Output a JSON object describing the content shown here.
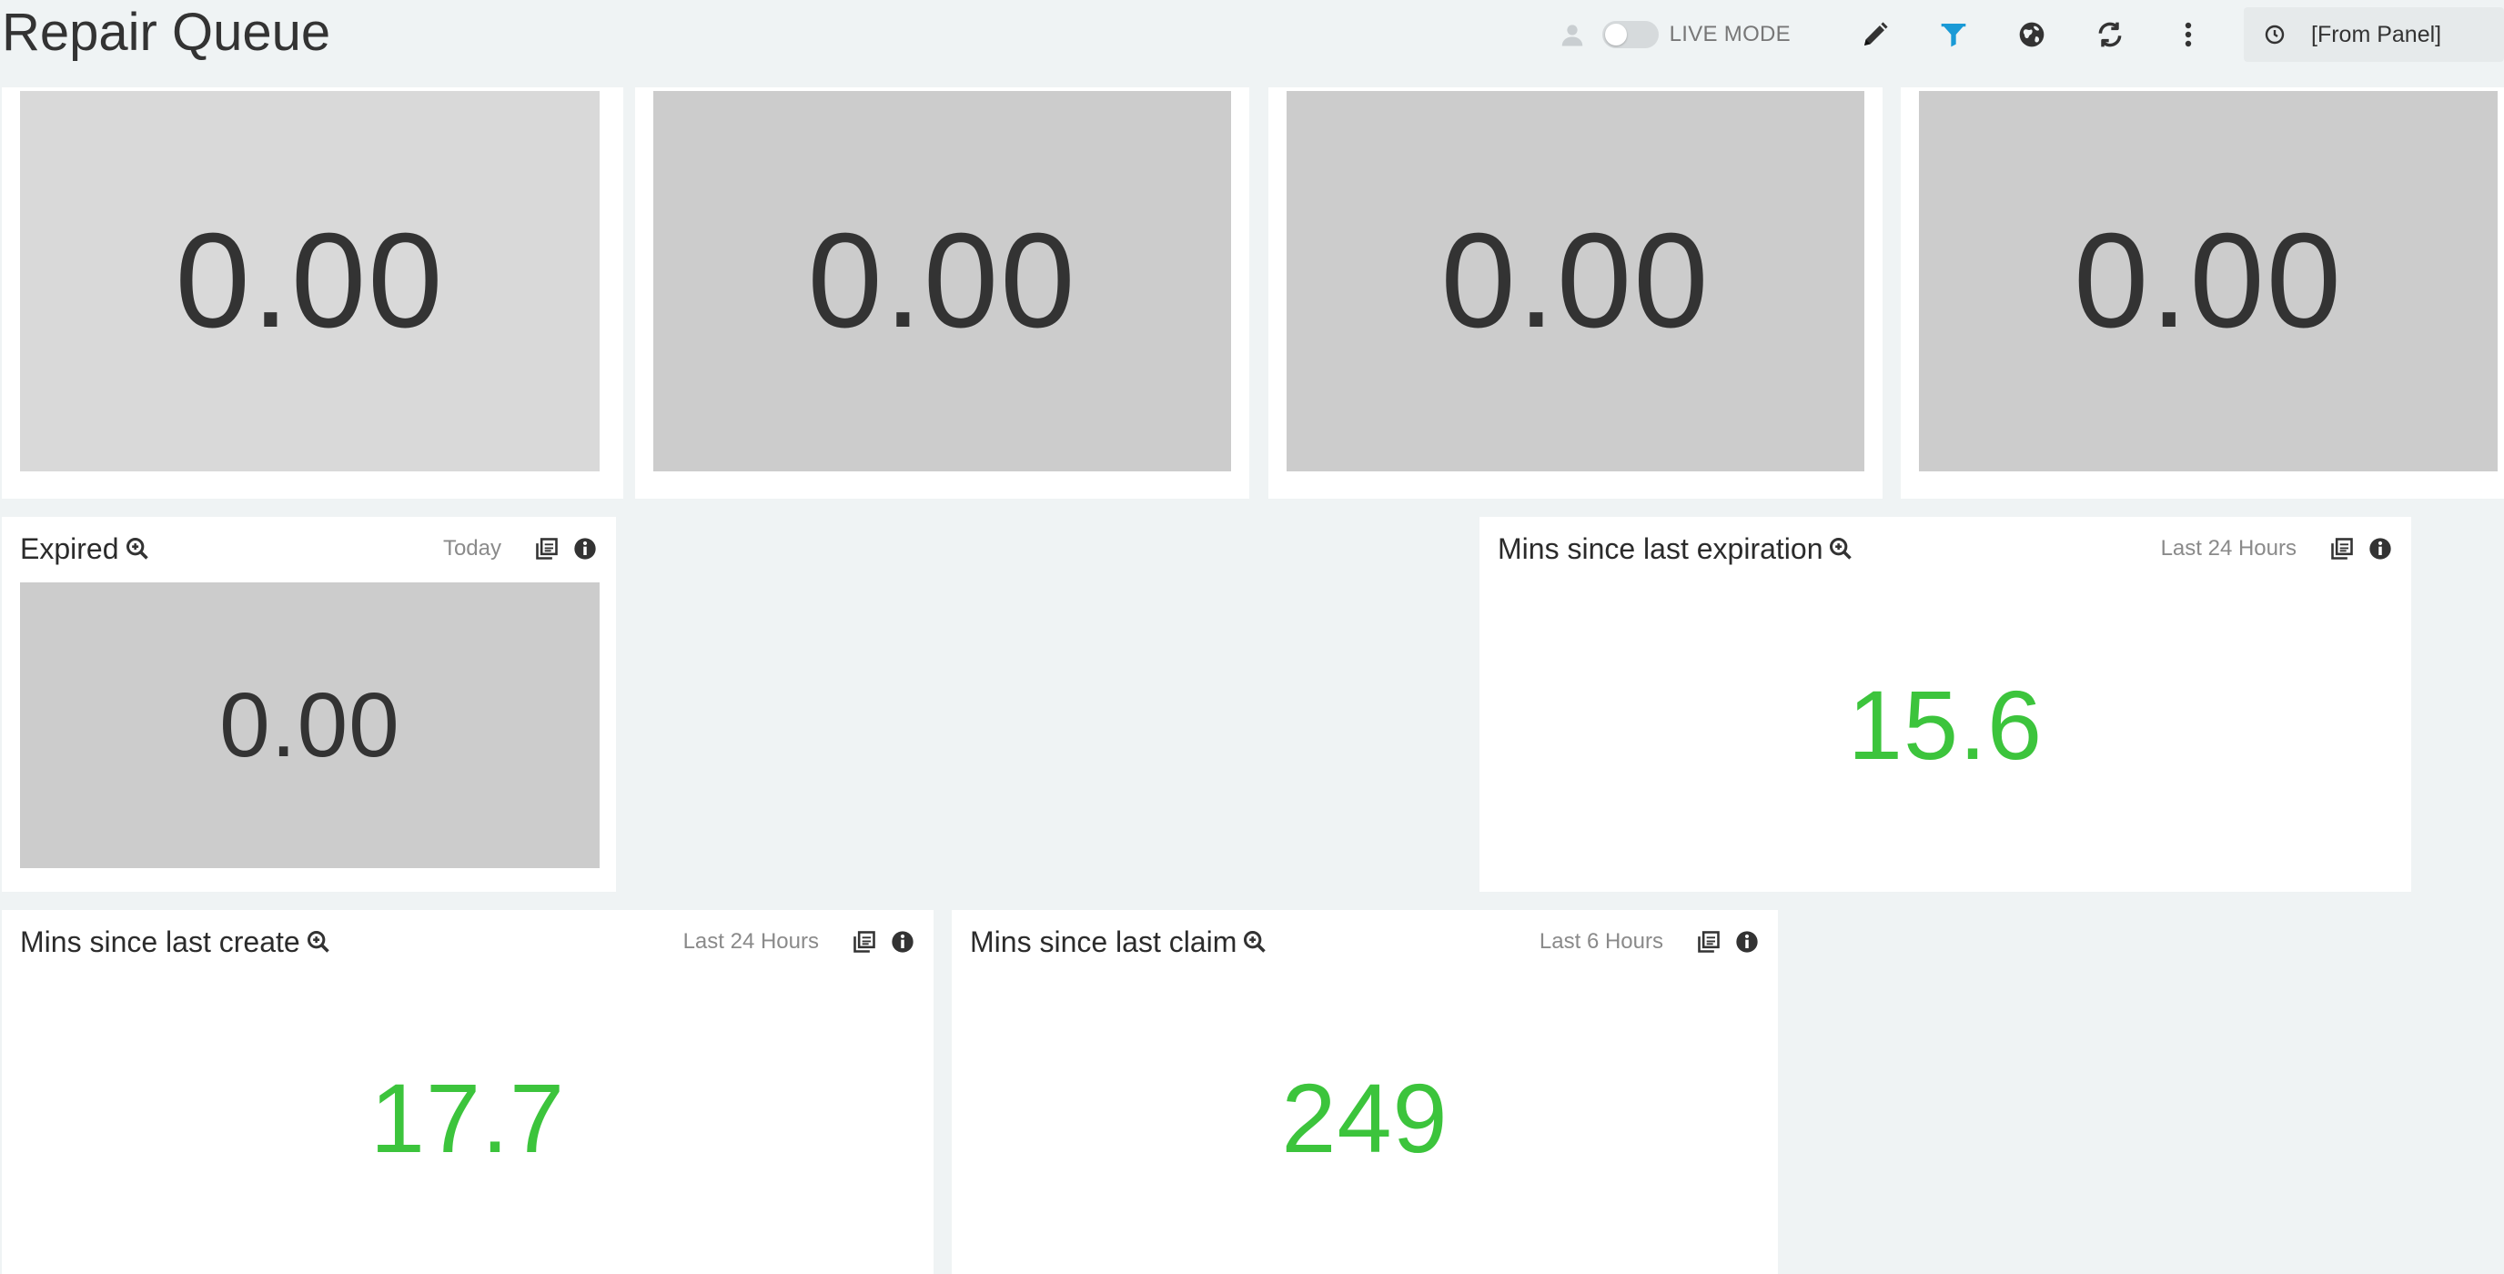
{
  "header": {
    "title": "Repair Queue",
    "live_mode_label": "LIVE MODE",
    "time_range": "[From Panel]"
  },
  "top_panels": [
    {
      "value": "0.00"
    },
    {
      "value": "0.00"
    },
    {
      "value": "0.00"
    },
    {
      "value": "0.00"
    }
  ],
  "expired": {
    "title": "Expired",
    "range": "Today",
    "value": "0.00"
  },
  "mins_since_last_expiration": {
    "title": "Mins since last expiration",
    "range": "Last 24 Hours",
    "value": "15.6"
  },
  "mins_since_last_create": {
    "title": "Mins since last create",
    "range": "Last 24 Hours",
    "value": "17.7"
  },
  "mins_since_last_claim": {
    "title": "Mins since last claim",
    "range": "Last 6 Hours",
    "value": "249"
  },
  "colors": {
    "accent_blue": "#1a9ad6",
    "value_green": "#3cc43c",
    "stat_gray": "#cccccc"
  },
  "icons": {
    "user": "user-icon",
    "edit": "pencil-icon",
    "filter": "filter-icon",
    "globe": "globe-icon",
    "refresh": "refresh-icon",
    "more": "more-vertical-icon",
    "clock": "clock-icon",
    "zoom": "zoom-in-icon",
    "copy": "copy-icon",
    "info": "info-icon"
  }
}
